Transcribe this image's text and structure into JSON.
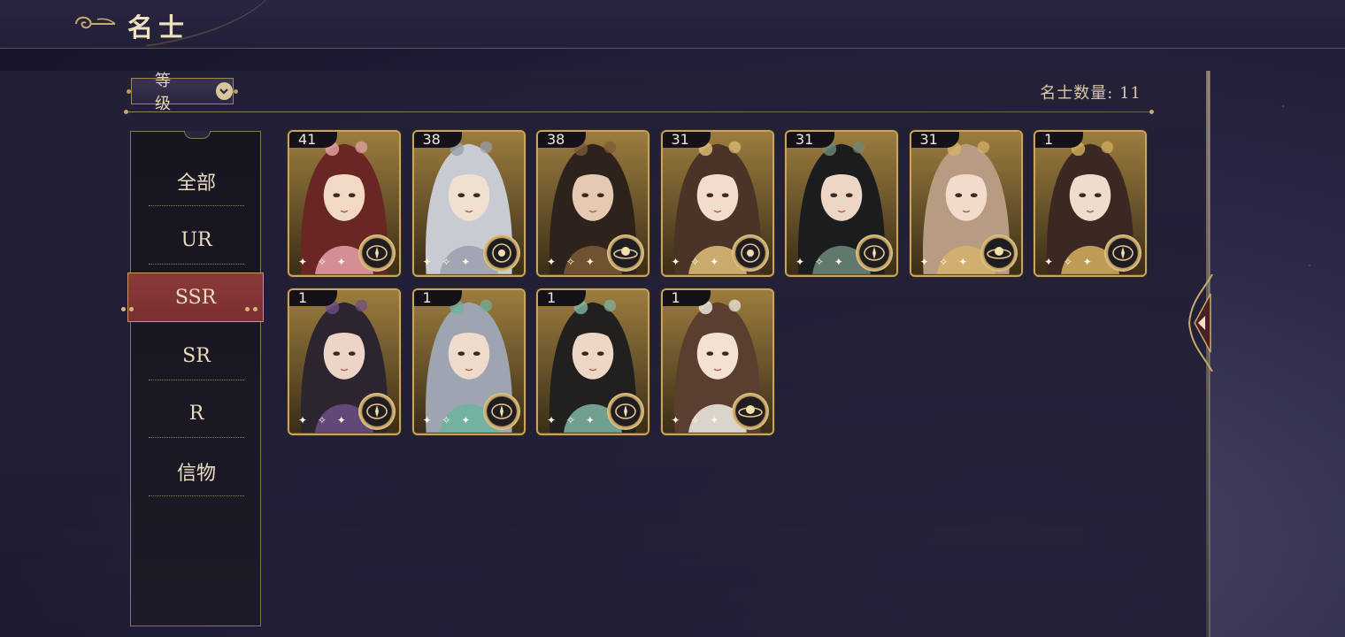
{
  "header": {
    "title": "名士"
  },
  "toolbar": {
    "sort_label": "等级",
    "count_text": "名士数量: 11"
  },
  "menu": {
    "items": [
      {
        "label": "全部",
        "active": false
      },
      {
        "label": "UR",
        "active": false
      },
      {
        "label": "SSR",
        "active": true
      },
      {
        "label": "SR",
        "active": false
      },
      {
        "label": "R",
        "active": false
      },
      {
        "label": "信物",
        "active": false
      }
    ]
  },
  "cards": [
    {
      "level": "41",
      "hair": "#6a2622",
      "skin": "#f1d9c6",
      "accent": "#e8a2a8",
      "badge": "compass-icon",
      "stars": "✦ ✧ ✦"
    },
    {
      "level": "38",
      "hair": "#c9cbd2",
      "skin": "#efe0d0",
      "accent": "#9aa0ad",
      "badge": "orbit-icon",
      "stars": "✦ ✧ ✦"
    },
    {
      "level": "38",
      "hair": "#2e221c",
      "skin": "#e6c9b2",
      "accent": "#7b5a35",
      "badge": "planet-icon",
      "stars": "✦ ✧ ✦"
    },
    {
      "level": "31",
      "hair": "#4a3427",
      "skin": "#f2ddcc",
      "accent": "#e2c07a",
      "badge": "orbit-icon",
      "stars": "✦ ✧ ✦"
    },
    {
      "level": "31",
      "hair": "#1a1c1d",
      "skin": "#ecd7c6",
      "accent": "#6e8a7a",
      "badge": "compass-icon",
      "stars": "✦ ✧ ✦"
    },
    {
      "level": "31",
      "hair": "#b79c82",
      "skin": "#f1dccb",
      "accent": "#d7b26c",
      "badge": "planet-icon",
      "stars": "✦ ✧ ✦"
    },
    {
      "level": "1",
      "hair": "#3b2823",
      "skin": "#f0dccd",
      "accent": "#d6b062",
      "badge": "compass-icon",
      "stars": "✦ ✧ ✦"
    },
    {
      "level": "1",
      "hair": "#2c2530",
      "skin": "#ecd5c6",
      "accent": "#6c4e86",
      "badge": "compass-icon",
      "stars": "✦ ✧ ✦"
    },
    {
      "level": "1",
      "hair": "#9ea5b0",
      "skin": "#eedbcb",
      "accent": "#6bb3a0",
      "badge": "compass-icon",
      "stars": "✦ ✧ ✦"
    },
    {
      "level": "1",
      "hair": "#22201e",
      "skin": "#ecd8c4",
      "accent": "#7fb7a4",
      "badge": "compass-icon",
      "stars": "✦ ✧ ✦"
    },
    {
      "level": "1",
      "hair": "#5a3e30",
      "skin": "#f3e1d1",
      "accent": "#f2efe9",
      "badge": "planet-icon",
      "stars": "✦ ✧ ✦"
    }
  ],
  "colors": {
    "gold": "#c9a45e",
    "active_tab": "#8c3a3a",
    "panel_bg": "#231f37"
  }
}
